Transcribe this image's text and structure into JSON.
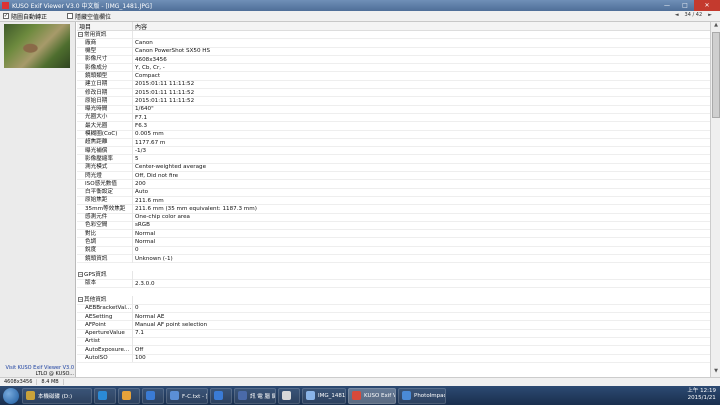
{
  "window": {
    "title": "KUSO Exif Viewer V3.0 中文版 - [IMG_1481.JPG]",
    "minimize": "—",
    "maximize": "□",
    "close": "✕"
  },
  "toolbar": {
    "auto_rotate_label": "隨圖自動轉正",
    "auto_rotate_checked": "✓",
    "hide_empty_label": "隱藏空值欄位",
    "prev": "◄",
    "counter": "34 / 42",
    "next": "►"
  },
  "left": {
    "visit_link": "Visit KUSO Exif Viewer V3.0",
    "credit": "LTLO @ KUSO..."
  },
  "table": {
    "col_key": "項目",
    "col_value": "內容",
    "groups": [
      {
        "title": "常用資訊",
        "rows": [
          [
            "廠商",
            "Canon"
          ],
          [
            "機型",
            "Canon PowerShot SX50 HS"
          ],
          [
            "影像尺寸",
            "4608x3456"
          ],
          [
            "影像成分",
            "Y, Cb, Cr, -"
          ],
          [
            "鏡頭類型",
            "Compact"
          ],
          [
            "建立日期",
            "2015:01:11 11:11:52"
          ],
          [
            "修改日期",
            "2015:01:11 11:11:52"
          ],
          [
            "原始日期",
            "2015:01:11 11:11:52"
          ],
          [
            "曝光時間",
            "1/640\""
          ],
          [
            "光圈大小",
            "F7.1"
          ],
          [
            "最大光圈",
            "F6.3"
          ],
          [
            "模糊圈(CoC)",
            "0.005 mm"
          ],
          [
            "超焦距離",
            "1177.67 m"
          ],
          [
            "曝光補償",
            "-1/3"
          ],
          [
            "影像壓縮率",
            "5"
          ],
          [
            "測光模式",
            "Center-weighted average"
          ],
          [
            "閃光燈",
            "Off, Did not fire"
          ],
          [
            "ISO感光數值",
            "200"
          ],
          [
            "白平衡設定",
            "Auto"
          ],
          [
            "原始焦距",
            "211.6 mm"
          ],
          [
            "35mm等效焦距",
            "211.6 mm (35 mm equivalent: 1187.3 mm)"
          ],
          [
            "感測元件",
            "One-chip color area"
          ],
          [
            "色彩空間",
            "sRGB"
          ],
          [
            "對比",
            "Normal"
          ],
          [
            "色調",
            "Normal"
          ],
          [
            "銳度",
            "0"
          ],
          [
            "鏡頭資訊",
            "Unknown (-1)"
          ]
        ]
      },
      {
        "title": "GPS資訊",
        "rows": [
          [
            "版本",
            "2.3.0.0"
          ]
        ]
      },
      {
        "title": "其他資訊",
        "rows": [
          [
            "AEBBracketVal...",
            "0"
          ],
          [
            "AESetting",
            "Normal AE"
          ],
          [
            "AFPoint",
            "Manual AF point selection"
          ],
          [
            "ApertureValue",
            "7.1"
          ],
          [
            "Artist",
            ""
          ],
          [
            "AutoExposure...",
            "Off"
          ],
          [
            "AutoISO",
            "100"
          ]
        ]
      }
    ]
  },
  "statusbar": {
    "dims": "4608x3456",
    "size": "8.4 MB"
  },
  "taskbar": {
    "items": [
      {
        "label": "本機磁碟 (D:)",
        "color": "#c9a23a",
        "w": 70
      },
      {
        "label": "",
        "color": "#2b8ad6",
        "w": 22
      },
      {
        "label": "",
        "color": "#e6a23a",
        "w": 22
      },
      {
        "label": "",
        "color": "#3a7bd5",
        "w": 22
      },
      {
        "label": "F-C.txt - 記...",
        "color": "#5b8fd6",
        "w": 42
      },
      {
        "label": "",
        "color": "#3a7bd5",
        "w": 22
      },
      {
        "label": "訊 電 腦 鍵盤...",
        "color": "#4a6aa8",
        "w": 42
      },
      {
        "label": "",
        "color": "#d8d8d8",
        "w": 22
      },
      {
        "label": "IMG_1481.J...",
        "color": "#8ab4e8",
        "w": 44
      },
      {
        "label": "KUSO Exif Vi...",
        "color": "#d94a3a",
        "w": 48,
        "active": true
      },
      {
        "label": "PhotoImpac...",
        "color": "#4a8ad6",
        "w": 48
      }
    ],
    "time": "上午 12:19",
    "date": "2015/1/21"
  }
}
